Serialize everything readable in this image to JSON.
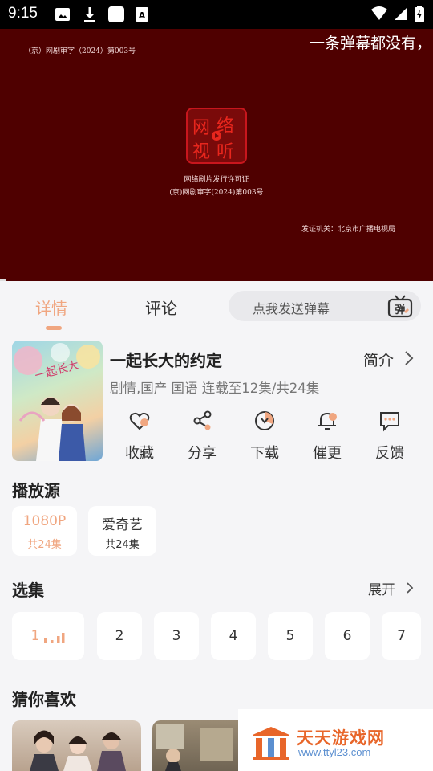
{
  "status_bar": {
    "time": "9:15",
    "icons": [
      "image-icon",
      "download-icon",
      "square-app-icon",
      "font-a-icon"
    ],
    "right_icons": [
      "wifi-icon",
      "signal-icon",
      "battery-icon"
    ]
  },
  "video": {
    "license_top": "（京）网剧审字（2024）第003号",
    "danmu_text": "一条弹幕都没有，",
    "cert_line1": "网络剧片发行许可证",
    "cert_line2": "(京)网剧审字(2024)第003号",
    "issuer": "发证机关：北京市广播电视局"
  },
  "tabs": {
    "detail": "详情",
    "comment": "评论",
    "danmu_placeholder": "点我发送弹幕",
    "danmu_button": "弹"
  },
  "movie": {
    "title": "一起长大的约定",
    "intro_label": "简介",
    "meta": "剧情,国产 国语 连载至12集/共24集",
    "actions": [
      {
        "label": "收藏",
        "icon": "heart-icon"
      },
      {
        "label": "分享",
        "icon": "share-icon"
      },
      {
        "label": "下载",
        "icon": "download-icon"
      },
      {
        "label": "催更",
        "icon": "bell-icon"
      },
      {
        "label": "反馈",
        "icon": "feedback-icon"
      }
    ]
  },
  "sources": {
    "title": "播放源",
    "items": [
      {
        "quality": "1080P",
        "count": "共24集",
        "selected": true
      },
      {
        "quality": "爱奇艺",
        "count": "共24集",
        "selected": false
      }
    ]
  },
  "episodes": {
    "title": "选集",
    "expand_label": "展开",
    "items": [
      "1",
      "2",
      "3",
      "4",
      "5",
      "6",
      "7"
    ]
  },
  "recommend": {
    "title": "猜你喜欢"
  },
  "watermark": {
    "name": "天天游戏网",
    "url": "www.ttyl23.com"
  },
  "colors": {
    "accent": "#f0a680",
    "video_bg": "#4f0000",
    "page_bg": "#f5f5f7"
  }
}
